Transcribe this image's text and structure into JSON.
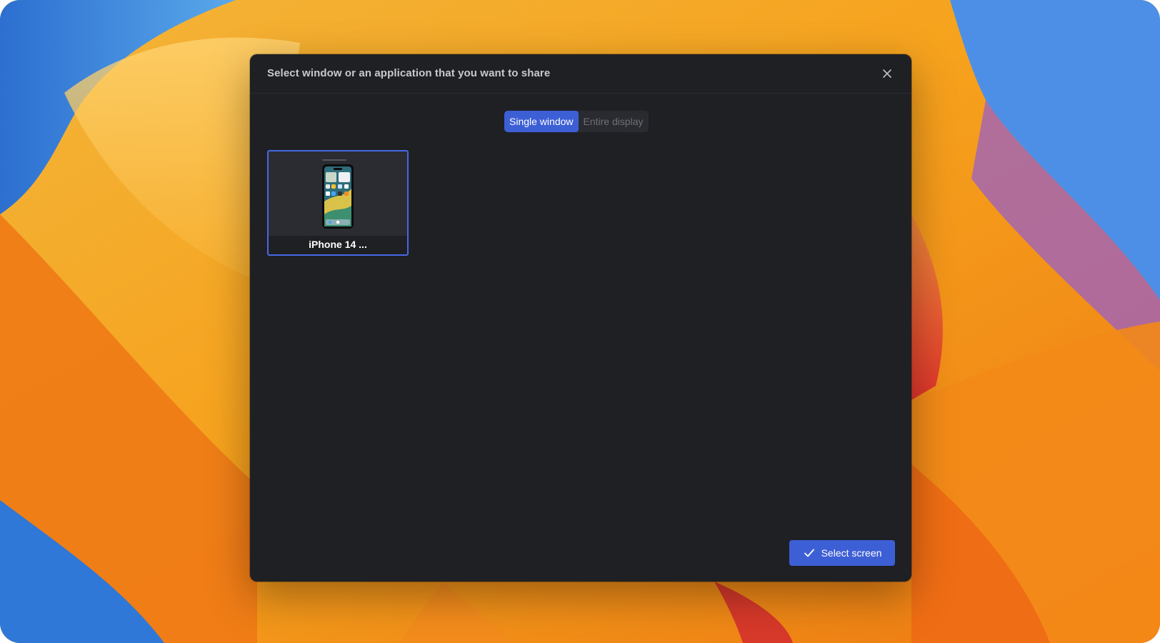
{
  "dialog": {
    "title": "Select window or an application that you want to share",
    "close_icon": "close-icon"
  },
  "tabs": [
    {
      "label": "Single window",
      "active": true
    },
    {
      "label": "Entire display",
      "active": false
    }
  ],
  "windows": [
    {
      "label": "iPhone 14 ...",
      "selected": true,
      "thumbnail_icon": "iphone-preview"
    }
  ],
  "actions": {
    "select_label": "Select screen",
    "select_icon": "check-icon"
  },
  "colors": {
    "dialog_bg": "#1f2024",
    "accent": "#3d5fd6",
    "selected_border": "#4569e6",
    "wallpaper_primary": "#f59a1e"
  }
}
